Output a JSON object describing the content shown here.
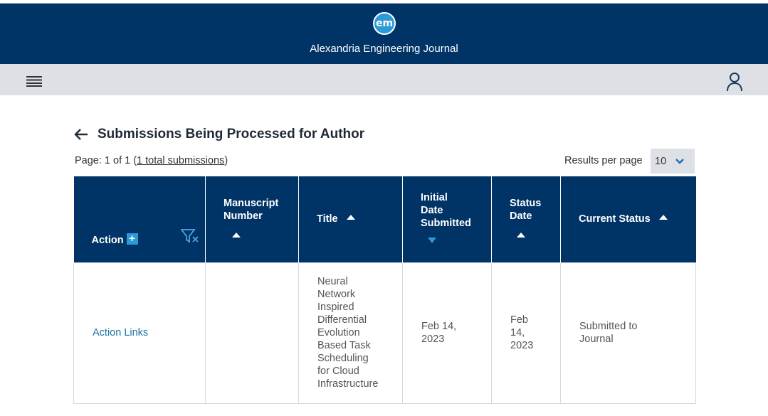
{
  "header": {
    "logo_text": "em",
    "journal_title": "Alexandria Engineering Journal",
    "background": "#003366"
  },
  "navbar": {
    "menu_icon": "hamburger-menu-icon",
    "user_icon": "user-icon"
  },
  "page": {
    "back_icon": "arrow-left-icon",
    "title": "Submissions Being Processed for Author",
    "page_label": "Page: 1 of 1 (",
    "total_link": "1 total submissions",
    "page_suffix": ")",
    "results_label": "Results per page",
    "results_value": "10"
  },
  "table": {
    "headers": {
      "action": "Action",
      "manuscript_l1": "Manuscript",
      "manuscript_l2": "Number",
      "title": "Title",
      "initial_l1": "Initial",
      "initial_l2": "Date",
      "initial_l3": "Submitted",
      "status_l1": "Status",
      "status_l2": "Date",
      "current_status": "Current Status"
    },
    "rows": [
      {
        "action": "Action Links",
        "manuscript_number": "",
        "title_lines": [
          "Neural",
          "Network",
          "Inspired",
          "Differential",
          "Evolution",
          "Based Task",
          "Scheduling",
          "for Cloud",
          "Infrastructure"
        ],
        "initial_date_lines": [
          "Feb 14,",
          "2023"
        ],
        "status_date_lines": [
          "Feb",
          "14,",
          "2023"
        ],
        "current_status_lines": [
          "Submitted to",
          "Journal"
        ]
      }
    ]
  },
  "colors": {
    "accent": "#2d9ad8",
    "navbar": "#dde1e6",
    "link": "#1d73a8"
  }
}
